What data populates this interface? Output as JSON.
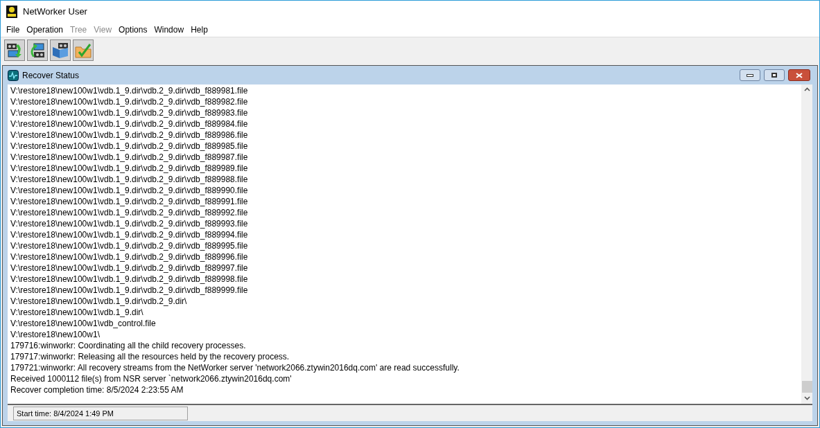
{
  "window": {
    "title": "NetWorker User"
  },
  "menu": [
    {
      "label": "File",
      "disabled": false
    },
    {
      "label": "Operation",
      "disabled": false
    },
    {
      "label": "Tree",
      "disabled": true
    },
    {
      "label": "View",
      "disabled": true
    },
    {
      "label": "Options",
      "disabled": false
    },
    {
      "label": "Window",
      "disabled": false
    },
    {
      "label": "Help",
      "disabled": false
    }
  ],
  "toolbar": [
    {
      "kind": "recover"
    },
    {
      "kind": "backup"
    },
    {
      "kind": "media"
    },
    {
      "kind": "verify"
    }
  ],
  "child_window": {
    "title": "Recover Status",
    "log": [
      "V:\\restore18\\new100w1\\vdb.1_9.dir\\vdb.2_9.dir\\vdb_f889981.file",
      "V:\\restore18\\new100w1\\vdb.1_9.dir\\vdb.2_9.dir\\vdb_f889982.file",
      "V:\\restore18\\new100w1\\vdb.1_9.dir\\vdb.2_9.dir\\vdb_f889983.file",
      "V:\\restore18\\new100w1\\vdb.1_9.dir\\vdb.2_9.dir\\vdb_f889984.file",
      "V:\\restore18\\new100w1\\vdb.1_9.dir\\vdb.2_9.dir\\vdb_f889986.file",
      "V:\\restore18\\new100w1\\vdb.1_9.dir\\vdb.2_9.dir\\vdb_f889985.file",
      "V:\\restore18\\new100w1\\vdb.1_9.dir\\vdb.2_9.dir\\vdb_f889987.file",
      "V:\\restore18\\new100w1\\vdb.1_9.dir\\vdb.2_9.dir\\vdb_f889989.file",
      "V:\\restore18\\new100w1\\vdb.1_9.dir\\vdb.2_9.dir\\vdb_f889988.file",
      "V:\\restore18\\new100w1\\vdb.1_9.dir\\vdb.2_9.dir\\vdb_f889990.file",
      "V:\\restore18\\new100w1\\vdb.1_9.dir\\vdb.2_9.dir\\vdb_f889991.file",
      "V:\\restore18\\new100w1\\vdb.1_9.dir\\vdb.2_9.dir\\vdb_f889992.file",
      "V:\\restore18\\new100w1\\vdb.1_9.dir\\vdb.2_9.dir\\vdb_f889993.file",
      "V:\\restore18\\new100w1\\vdb.1_9.dir\\vdb.2_9.dir\\vdb_f889994.file",
      "V:\\restore18\\new100w1\\vdb.1_9.dir\\vdb.2_9.dir\\vdb_f889995.file",
      "V:\\restore18\\new100w1\\vdb.1_9.dir\\vdb.2_9.dir\\vdb_f889996.file",
      "V:\\restore18\\new100w1\\vdb.1_9.dir\\vdb.2_9.dir\\vdb_f889997.file",
      "V:\\restore18\\new100w1\\vdb.1_9.dir\\vdb.2_9.dir\\vdb_f889998.file",
      "V:\\restore18\\new100w1\\vdb.1_9.dir\\vdb.2_9.dir\\vdb_f889999.file",
      "V:\\restore18\\new100w1\\vdb.1_9.dir\\vdb.2_9.dir\\",
      "V:\\restore18\\new100w1\\vdb.1_9.dir\\",
      "V:\\restore18\\new100w1\\vdb_control.file",
      "V:\\restore18\\new100w1\\",
      "179716:winworkr: Coordinating all the child recovery processes.",
      "179717:winworkr: Releasing all the resources held by the recovery process.",
      "179721:winworkr: All recovery streams from the NetWorker server 'network2066.ztywin2016dq.com' are read successfully.",
      "Received 1000112 file(s) from NSR server `network2066.ztywin2016dq.com'",
      "Recover completion time: 8/5/2024 2:23:55 AM"
    ],
    "status": "Start time: 8/4/2024 1:49 PM"
  }
}
